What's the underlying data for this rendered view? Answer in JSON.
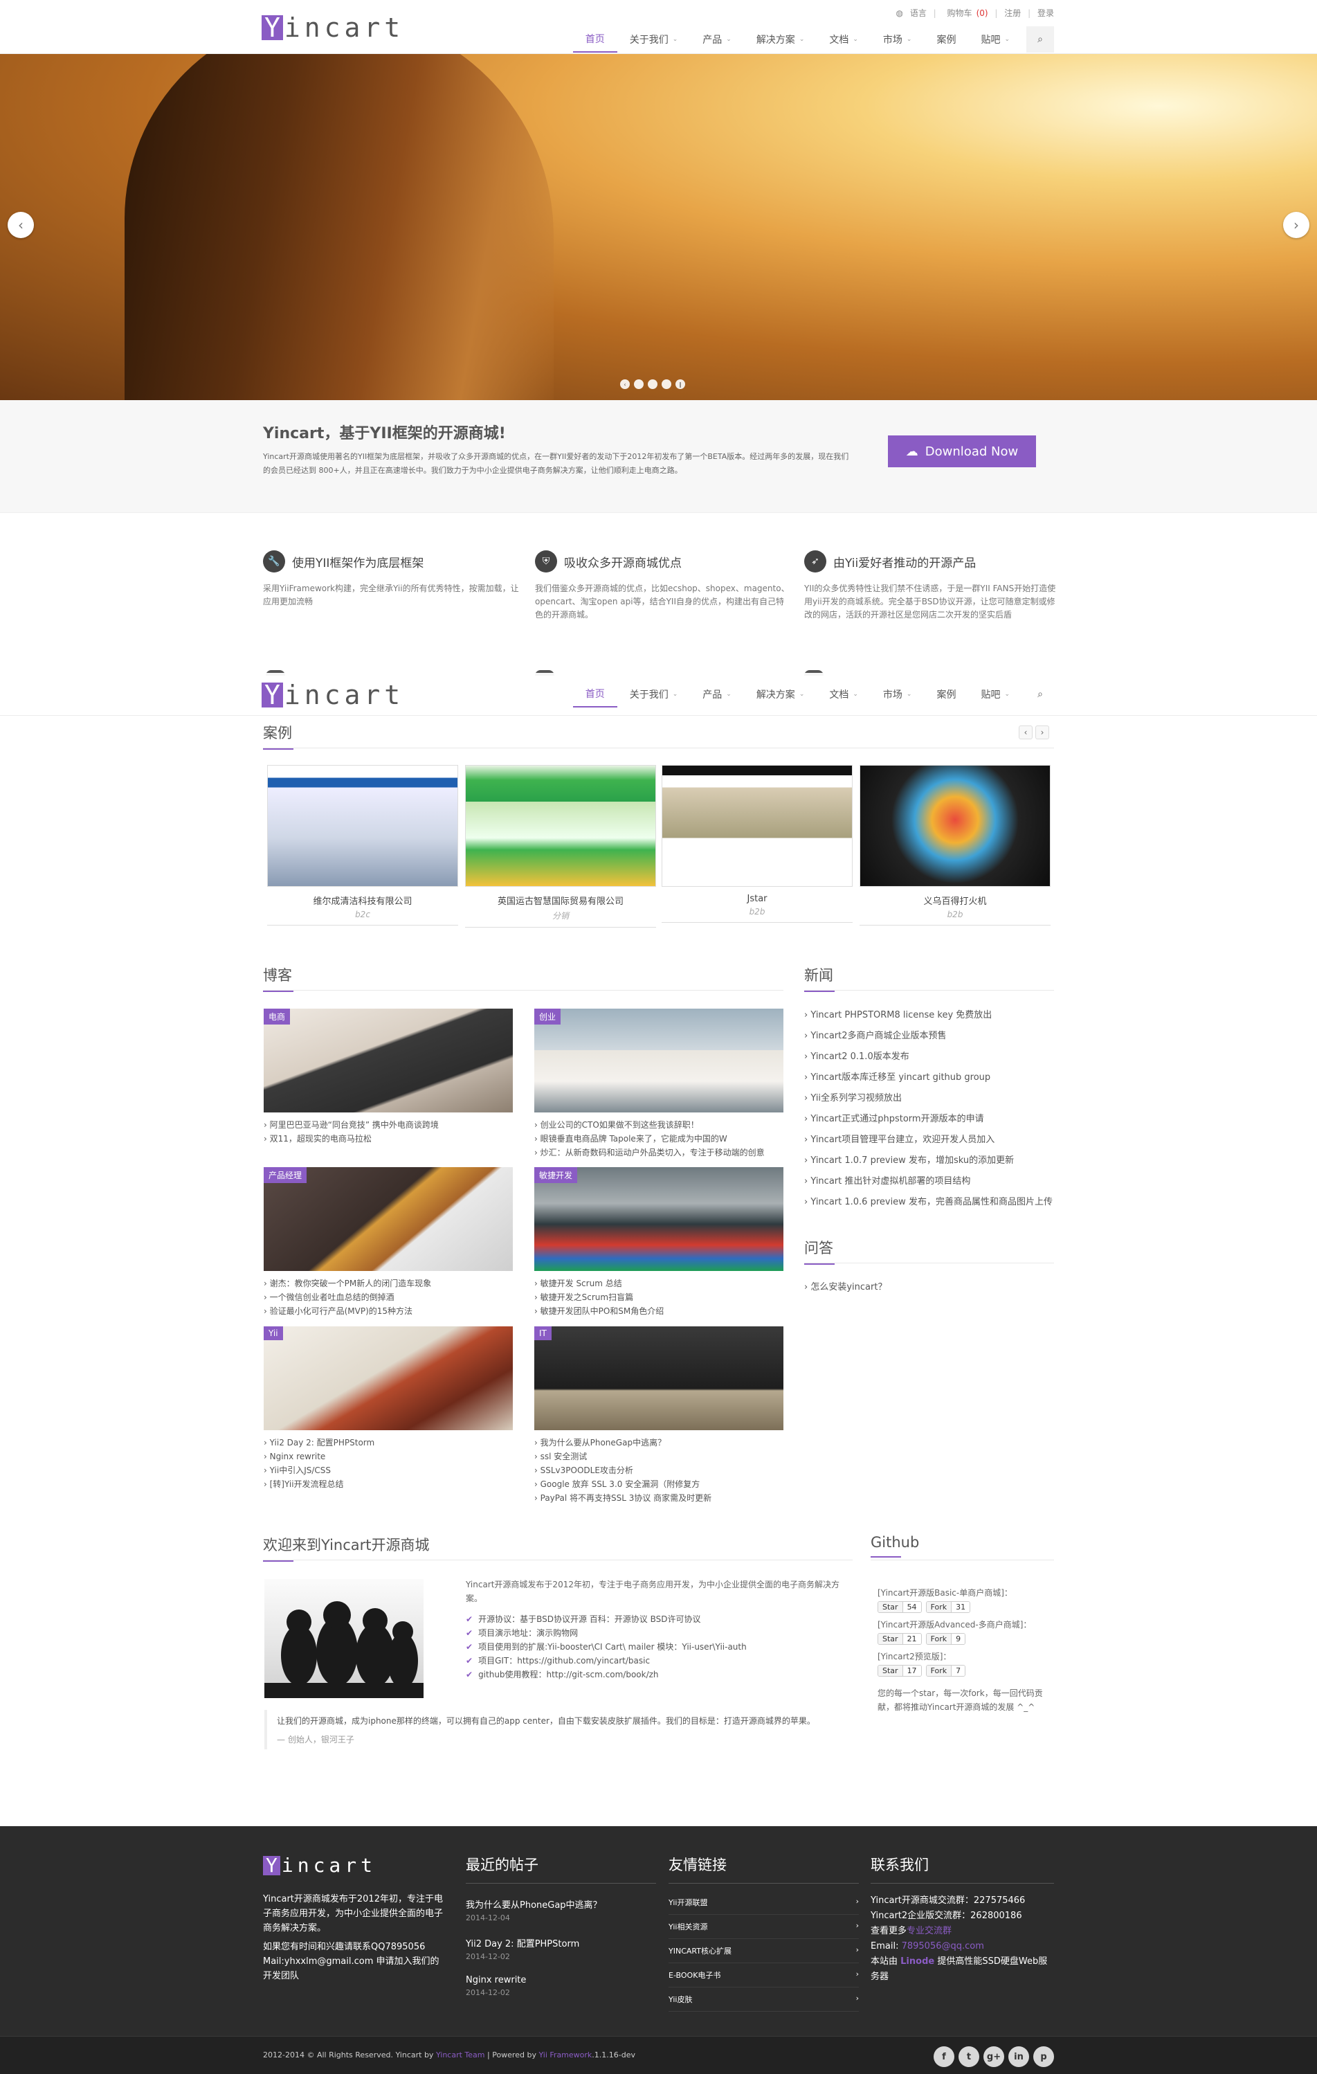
{
  "header": {
    "logo_letter": "Y",
    "logo_rest": "incart",
    "util": {
      "lang": "语言",
      "cart": "购物车",
      "cart_count": "(0)",
      "register": "注册",
      "login": "登录"
    },
    "nav": [
      {
        "label": "首页",
        "active": true,
        "caret": false
      },
      {
        "label": "关于我们",
        "caret": true
      },
      {
        "label": "产品",
        "caret": true
      },
      {
        "label": "解决方案",
        "caret": true
      },
      {
        "label": "文档",
        "caret": true
      },
      {
        "label": "市场",
        "caret": true
      },
      {
        "label": "案例",
        "caret": false
      },
      {
        "label": "贴吧",
        "caret": true
      }
    ]
  },
  "intro": {
    "title": "Yincart，基于YII框架的开源商城!",
    "text": "Yincart开源商城使用著名的YII框架为底层框架，并吸收了众多开源商城的优点，在一群YII爱好者的发动下于2012年初发布了第一个BETA版本。经过两年多的发展，现在我们的会员已经达到 800+人，并且正在高速增长中。我们致力于为中小企业提供电子商务解决方案，让他们顺利走上电商之路。",
    "download": "Download Now"
  },
  "features": [
    {
      "icon": "wrench-icon",
      "glyph": "🔧",
      "title": "使用YII框架作为底层框架",
      "text": "采用YiiFramework构建，完全继承Yii的所有优秀特性，按需加载，让应用更加流畅"
    },
    {
      "icon": "shield-icon",
      "glyph": "⛨",
      "title": "吸收众多开源商城优点",
      "text": "我们借鉴众多开源商城的优点，比如ecshop、shopex、magento、opencart、淘宝open api等，结合YII自身的优点，构建出有自己特色的开源商城。"
    },
    {
      "icon": "rocket-icon",
      "glyph": "➶",
      "title": "由Yii爱好者推动的开源产品",
      "text": "YII的众多优秀特性让我们禁不住诱惑，于是一群YII FANS开始打造使用yii开发的商城系统。完全基于BSD协议开源，让您可随意定制或修改的网店，活跃的开源社区是您网店二次开发的坚实后盾"
    }
  ],
  "cases": {
    "title": "案例",
    "items": [
      {
        "name": "维尔成清洁科技有限公司",
        "tag": "b2c"
      },
      {
        "name": "英国运古智慧国际贸易有限公司",
        "tag": "分销"
      },
      {
        "name": "Jstar",
        "tag": "b2b"
      },
      {
        "name": "义乌百得打火机",
        "tag": "b2b"
      }
    ]
  },
  "blog": {
    "title": "博客",
    "cards": [
      {
        "tag": "电商",
        "items": [
          "阿里巴巴亚马逊“同台竞技” 携中外电商谈跨境",
          "双11，超现实的电商马拉松"
        ]
      },
      {
        "tag": "创业",
        "items": [
          "创业公司的CTO如果做不到这些我该辞职！",
          "眼镜垂直电商品牌 Tapole来了，它能成为中国的W",
          "炒汇：从新奇数码和运动户外品类切入，专注于移动端的创意"
        ]
      },
      {
        "tag": "产品经理",
        "items": [
          "谢杰：教你突破一个PM新人的闭门造车现象",
          "一个微信创业者吐血总结的倒掉酒",
          "验证最小化可行产品(MVP)的15种方法"
        ]
      },
      {
        "tag": "敏捷开发",
        "items": [
          "敏捷开发 Scrum 总结",
          "敏捷开发之Scrum扫盲篇",
          "敏捷开发团队中PO和SM角色介绍"
        ]
      },
      {
        "tag": "Yii",
        "items": [
          "Yii2 Day 2: 配置PHPStorm",
          "Nginx rewrite",
          "Yii中引入JS/CSS",
          "[转]Yii开发流程总结"
        ]
      },
      {
        "tag": "IT",
        "items": [
          "我为什么要从PhoneGap中逃离？",
          "ssl 安全测试",
          "SSLv3POODLE攻击分析",
          "Google 放弃 SSL 3.0 安全漏洞（附修复方",
          "PayPal 将不再支持SSL 3协议 商家需及时更新"
        ]
      }
    ]
  },
  "news": {
    "title": "新闻",
    "items": [
      "Yincart PHPSTORM8 license key 免费放出",
      "Yincart2多商户商城企业版本预售",
      "Yincart2 0.1.0版本发布",
      "Yincart版本库迁移至 yincart github group",
      "Yii全系列学习视频放出",
      "Yincart正式通过phpstorm开源版本的申请",
      "Yincart项目管理平台建立，欢迎开发人员加入",
      "Yincart 1.0.7 preview 发布，增加sku的添加更新",
      "Yincart 推出针对虚拟机部署的项目结构",
      "Yincart 1.0.6 preview 发布，完善商品属性和商品图片上传"
    ]
  },
  "qa": {
    "title": "问答",
    "items": [
      "怎么安装yincart？"
    ]
  },
  "welcome": {
    "title": "欢迎来到Yincart开源商城",
    "text": "Yincart开源商城发布于2012年初，专注于电子商务应用开发，为中小企业提供全面的电子商务解决方案。",
    "list": [
      "开源协议：基于BSD协议开源 百科：开源协议 BSD许可协议",
      "项目演示地址：演示购物网",
      "项目使用到的扩展:Yii-booster\\CI Cart\\ mailer 模块：Yii-user\\Yii-auth",
      "项目GIT：https://github.com/yincart/basic",
      "github使用教程：http://git-scm.com/book/zh"
    ],
    "quote": "让我们的开源商城，成为iphone那样的终端，可以拥有自己的app center，自由下载安装皮肤扩展插件。我们的目标是：打造开源商城界的苹果。",
    "quote_author": "— 创始人，银河王子"
  },
  "github": {
    "title": "Github",
    "repos": [
      {
        "name": "[Yincart开源版Basic-单商户商城]：",
        "star": "Star",
        "stars": "54",
        "fork": "Fork",
        "forks": "31"
      },
      {
        "name": "[Yincart开源版Advanced-多商户商城]：",
        "star": "Star",
        "stars": "21",
        "fork": "Fork",
        "forks": "9"
      },
      {
        "name": "[Yincart2预览版]：",
        "star": "Star",
        "stars": "17",
        "fork": "Fork",
        "forks": "7"
      }
    ],
    "note": "您的每一个star，每一次fork，每一回代码贡献，都将推动Yincart开源商城的发展 ^_^"
  },
  "footer": {
    "about1": "Yincart开源商城发布于2012年初，专注于电子商务应用开发，为中小企业提供全面的电子商务解决方案。",
    "about2": "如果您有时间和兴趣请联系QQ7895056 Mail:yhxxlm@gmail.com 申请加入我们的开发团队",
    "recent_title": "最近的帖子",
    "posts": [
      {
        "title": "我为什么要从PhoneGap中逃离？",
        "date": "2014-12-04"
      },
      {
        "title": "Yii2 Day 2: 配置PHPStorm",
        "date": "2014-12-02"
      },
      {
        "title": "Nginx rewrite",
        "date": "2014-12-02"
      }
    ],
    "links_title": "友情链接",
    "links": [
      "Yii开源联盟",
      "Yii相关资源",
      "YINCART核心扩展",
      "E-BOOK电子书",
      "Yii皮肤"
    ],
    "contact_title": "联系我们",
    "contact": {
      "qq1": "Yincart开源商城交流群：227575466",
      "qq2": "Yincart2企业版交流群：262800186",
      "more_prefix": "查看更多",
      "more_link": "专业交流群",
      "email_prefix": "Email: ",
      "email": "7895056@qq.com",
      "host_prefix": "本站由 ",
      "host": "Linode",
      "host_suffix": " 提供高性能SSD硬盘Web服务器"
    },
    "copyright_a": "2012-2014 © All Rights Reserved. Yincart by ",
    "copyright_team": "Yincart Team",
    "copyright_b": " | Powered by ",
    "copyright_fw": "Yii Framework",
    "copyright_c": ".1.1.16-dev",
    "social": [
      "f",
      "t",
      "g+",
      "in",
      "p"
    ]
  },
  "colors": {
    "accent": "#8a5cc4",
    "footer_bg": "#2c2c2c"
  }
}
